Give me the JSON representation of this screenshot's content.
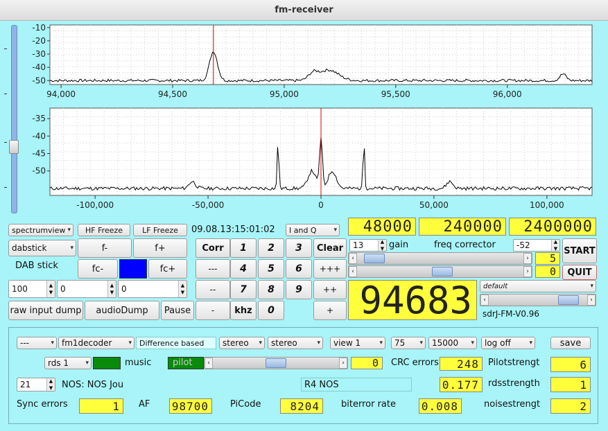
{
  "window": {
    "title": "fm-receiver"
  },
  "spectrum_top": {
    "y_ticks": [
      "-10",
      "-20",
      "-30",
      "-40",
      "-50"
    ],
    "x_ticks": [
      "94,000",
      "94,500",
      "95,000",
      "95,500",
      "96,000"
    ],
    "x_range": [
      93950,
      96380
    ],
    "y_range": [
      -8,
      -53
    ],
    "marker": 94683
  },
  "spectrum_bottom": {
    "y_ticks": [
      "-35",
      "-40",
      "-45",
      "-50"
    ],
    "x_ticks": [
      "-100,000",
      "-50,000",
      "0",
      "50,000",
      "100,000"
    ],
    "x_range": [
      -120000,
      120000
    ],
    "y_range": [
      -32,
      -57
    ],
    "marker": 0
  },
  "controls": {
    "spectrumview": "spectrumview",
    "hf_freeze": "HF Freeze",
    "lf_freeze": "LF Freeze",
    "datetime": "09.08.13:15:01:02",
    "iq_mode": "I and Q",
    "device": "dabstick",
    "f_minus": "f-",
    "f_plus": "f+",
    "device_label": "DAB stick",
    "fc_minus": "fc-",
    "fc_plus": "fc+",
    "spin_100": "100",
    "spin_0a": "0",
    "spin_0b": "0",
    "raw_dump": "raw input dump",
    "audio_dump": "audioDump",
    "pause": "Pause",
    "corr": "Corr",
    "clear": "Clear",
    "k1": "1",
    "k2": "2",
    "k3": "3",
    "k4": "4",
    "k5": "5",
    "k6": "6",
    "k7": "7",
    "k8": "8",
    "k9": "9",
    "k0": "0",
    "dash3": "---",
    "dash2": "--",
    "dash1": "-",
    "plus3": "+++",
    "plus2": "++",
    "plus1": "+",
    "khz": "khz",
    "lcd1": "48000",
    "lcd2": "240000",
    "lcd3": "2400000",
    "gain_value": "13",
    "gain_label": "gain",
    "freq_corr_label": "freq corrector",
    "freq_corr_value": "-52",
    "start": "START",
    "quit": "QUIT",
    "small_lcd1": "5",
    "small_lcd2": "0",
    "freq_display": "94683",
    "profile": "default",
    "version": "sdrJ-FM-V0.96"
  },
  "bottom": {
    "combo_dash": "---",
    "decoder": "fm1decoder",
    "difference": "Difference based",
    "stereo1": "stereo",
    "stereo2": "stereo",
    "view": "view 1",
    "deemph": "75",
    "lowpass": "15000",
    "log": "log off",
    "save": "save",
    "rds": "rds 1",
    "music": "music",
    "pilot": "pilot",
    "rds_lcd": "0",
    "crc_label": "CRC errors",
    "crc_value": "248",
    "pilot_label": "Pilotstrengt",
    "pilot_value": "6",
    "spin21": "21",
    "nos": "NOS: NOS Jou",
    "r4nos": "R4 NOS",
    "rds_val": "0.177",
    "rds_label": "rdsstrength",
    "rds_str": "1",
    "sync_label": "Sync errors",
    "sync_value": "1",
    "af_label": "AF",
    "af_value": "98700",
    "picode_label": "PiCode",
    "picode_value": "8204",
    "biterror_label": "biterror rate",
    "biterror_value": "0.008",
    "noise_label": "noisestrengt",
    "noise_value": "2"
  }
}
